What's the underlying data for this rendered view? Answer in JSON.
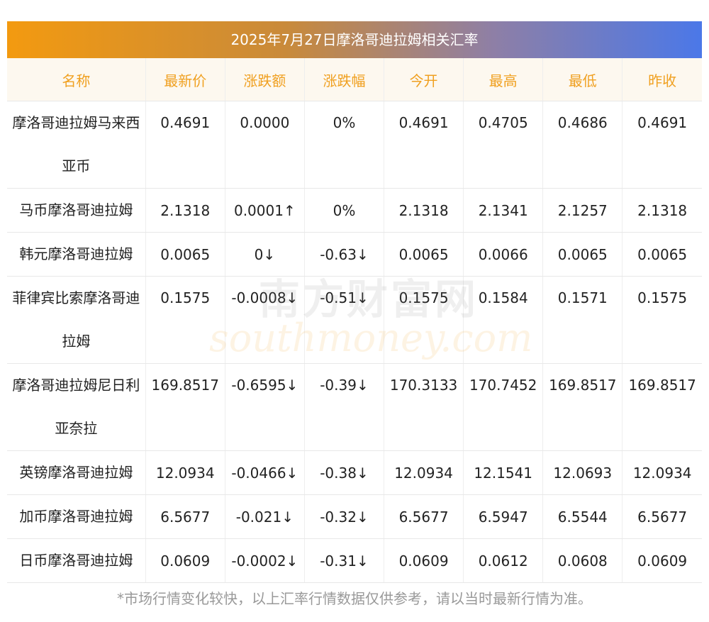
{
  "title": "2025年7月27日摩洛哥迪拉姆相关汇率",
  "columns": [
    "名称",
    "最新价",
    "涨跌额",
    "涨跌幅",
    "今开",
    "最高",
    "最低",
    "昨收"
  ],
  "rows": [
    {
      "name": "摩洛哥迪拉姆马来西亚币",
      "latest": "0.4691",
      "change": "0.0000",
      "pct": "0%",
      "open": "0.4691",
      "high": "0.4705",
      "low": "0.4686",
      "prev": "0.4691",
      "dir": "flat",
      "latest_dir": "flat"
    },
    {
      "name": "马币摩洛哥迪拉姆",
      "latest": "2.1318",
      "change": "0.0001↑",
      "pct": "0%",
      "open": "2.1318",
      "high": "2.1341",
      "low": "2.1257",
      "prev": "2.1318",
      "dir": "up",
      "latest_dir": "flat",
      "pct_dir": "flat"
    },
    {
      "name": "韩元摩洛哥迪拉姆",
      "latest": "0.0065",
      "change": "0↓",
      "pct": "-0.63↓",
      "open": "0.0065",
      "high": "0.0066",
      "low": "0.0065",
      "prev": "0.0065",
      "dir": "down",
      "latest_dir": "down"
    },
    {
      "name": "菲律宾比索摩洛哥迪拉姆",
      "latest": "0.1575",
      "change": "-0.0008↓",
      "pct": "-0.51↓",
      "open": "0.1575",
      "high": "0.1584",
      "low": "0.1571",
      "prev": "0.1575",
      "dir": "down",
      "latest_dir": "down"
    },
    {
      "name": "摩洛哥迪拉姆尼日利亚奈拉",
      "latest": "169.8517",
      "change": "-0.6595↓",
      "pct": "-0.39↓",
      "open": "170.3133",
      "high": "170.7452",
      "low": "169.8517",
      "prev": "169.8517",
      "dir": "down",
      "latest_dir": "down"
    },
    {
      "name": "英镑摩洛哥迪拉姆",
      "latest": "12.0934",
      "change": "-0.0466↓",
      "pct": "-0.38↓",
      "open": "12.0934",
      "high": "12.1541",
      "low": "12.0693",
      "prev": "12.0934",
      "dir": "down",
      "latest_dir": "down"
    },
    {
      "name": "加币摩洛哥迪拉姆",
      "latest": "6.5677",
      "change": "-0.021↓",
      "pct": "-0.32↓",
      "open": "6.5677",
      "high": "6.5947",
      "low": "6.5544",
      "prev": "6.5677",
      "dir": "down",
      "latest_dir": "down"
    },
    {
      "name": "日币摩洛哥迪拉姆",
      "latest": "0.0609",
      "change": "-0.0002↓",
      "pct": "-0.31↓",
      "open": "0.0609",
      "high": "0.0612",
      "low": "0.0608",
      "prev": "0.0609",
      "dir": "down",
      "latest_dir": "down"
    }
  ],
  "watermark": {
    "cn": "南方财富网",
    "en": "southmoney.com"
  },
  "footer": "*市场行情变化较快，以上汇率行情数据仅供参考，请以当时最新行情为准。",
  "colors": {
    "header_text": "#f0a020",
    "up": "#e02020",
    "down": "#1a8a1a",
    "title_from": "#f39a10",
    "title_to": "#4b78e8"
  }
}
